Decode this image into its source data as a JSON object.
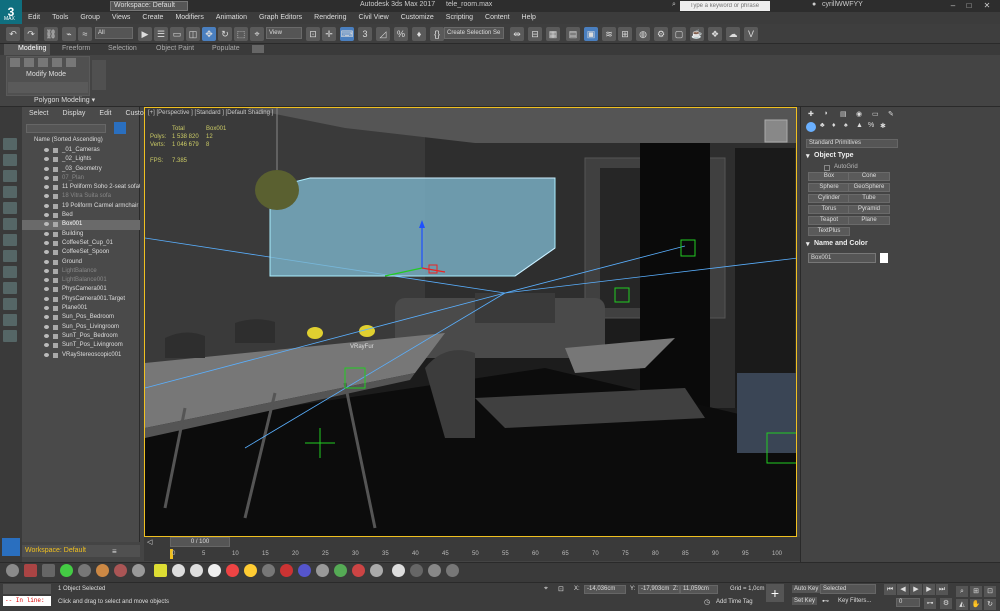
{
  "title_bar": {
    "logo_text": "3",
    "logo_sub": "MAX",
    "workspace": "Workspace: Default",
    "app_title": "Autodesk 3ds Max 2017",
    "file_name": "tele_room.max",
    "search_placeholder": "Type a keyword or phrase",
    "user": "cyrillWWFYY",
    "minimize": "–",
    "maximize": "□",
    "close": "✕"
  },
  "menu": [
    "Edit",
    "Tools",
    "Group",
    "Views",
    "Create",
    "Modifiers",
    "Animation",
    "Graph Editors",
    "Rendering",
    "Civil View",
    "Customize",
    "Scripting",
    "Content",
    "Help"
  ],
  "toolbar": {
    "filter": "All",
    "view": "View",
    "selection_set": "Create Selection Se",
    "undo": "↶",
    "redo": "↷",
    "link": "⛓",
    "select": "▶",
    "move": "✥",
    "rotate": "↻",
    "scale": "⬚",
    "snap": "3",
    "angle_snap": "◿",
    "percent_snap": "%",
    "spinner_snap": "♦",
    "mirror": "⇹",
    "align": "⊟",
    "render_setup": "⚙",
    "render": "☕"
  },
  "ribbon": {
    "tabs": [
      "Modeling",
      "Freeform",
      "Selection",
      "Object Paint",
      "Populate"
    ],
    "active_tab": "Modeling",
    "modify_mode": "Modify Mode",
    "polygon_modeling": "Polygon Modeling ▾"
  },
  "scene_explorer": {
    "tabs": [
      "Select",
      "Display",
      "Edit",
      "Customize"
    ],
    "header": "Name (Sorted Ascending)",
    "items": [
      {
        "name": "_01_Cameras",
        "state": "normal"
      },
      {
        "name": "_02_Lights",
        "state": "normal"
      },
      {
        "name": "_03_Geometry",
        "state": "normal"
      },
      {
        "name": "07_Plan",
        "state": "dim"
      },
      {
        "name": "11 Poliform Soho 2-seat sofa00",
        "state": "normal"
      },
      {
        "name": "18 Vitra Suita sofa",
        "state": "dim"
      },
      {
        "name": "19 Poliform Carmel armchair",
        "state": "normal"
      },
      {
        "name": "Bed",
        "state": "normal"
      },
      {
        "name": "Box001",
        "state": "sel"
      },
      {
        "name": "Building",
        "state": "normal"
      },
      {
        "name": "CoffeeSet_Cup_01",
        "state": "normal"
      },
      {
        "name": "CoffeeSet_Spoon",
        "state": "normal"
      },
      {
        "name": "Ground",
        "state": "normal"
      },
      {
        "name": "LightBalance",
        "state": "dim"
      },
      {
        "name": "LightBalance001",
        "state": "dim"
      },
      {
        "name": "PhysCamera001",
        "state": "normal"
      },
      {
        "name": "PhysCamera001.Target",
        "state": "normal"
      },
      {
        "name": "Plane001",
        "state": "normal"
      },
      {
        "name": "Sun_Pos_Bedroom",
        "state": "normal"
      },
      {
        "name": "Sun_Pos_Livingroom",
        "state": "normal"
      },
      {
        "name": "SunT_Pos_Bedroom",
        "state": "normal"
      },
      {
        "name": "SunT_Pos_Livingroom",
        "state": "normal"
      },
      {
        "name": "VRayStereoscopic001",
        "state": "normal"
      }
    ],
    "workspace": "Workspace: Default"
  },
  "viewport": {
    "label": "[+] [Perspective ] [Standard ] [Default Shading ]",
    "stats_total": "Total",
    "stats_object": "Box001",
    "polys_label": "Polys:",
    "polys_total": "1 538 820",
    "polys_obj": "12",
    "verts_label": "Verts:",
    "verts_total": "1 046 679",
    "verts_obj": "8",
    "fps_label": "FPS:",
    "fps": "7.385",
    "vray_label": "VRayFur"
  },
  "command_panel": {
    "category": "Standard Primitives",
    "object_type_header": "Object Type",
    "autogrid": "AutoGrid",
    "primitives": [
      "Box",
      "Cone",
      "Sphere",
      "GeoSphere",
      "Cylinder",
      "Tube",
      "Torus",
      "Pyramid",
      "Teapot",
      "Plane",
      "TextPlus"
    ],
    "name_color_header": "Name and Color",
    "object_name": "Box001",
    "object_color": "#ffffff"
  },
  "timeline": {
    "slider": "0 / 100",
    "ticks": [
      "0",
      "5",
      "10",
      "15",
      "20",
      "25",
      "30",
      "35",
      "40",
      "45",
      "50",
      "55",
      "60",
      "65",
      "70",
      "75",
      "80",
      "85",
      "90",
      "95",
      "100"
    ]
  },
  "status": {
    "maxscript": "-- In line:",
    "selected": "1 Object Selected",
    "hint": "Click and drag to select and move objects",
    "x_label": "X:",
    "x": "-14,036cm",
    "y_label": "Y:",
    "y": "-17,903cm",
    "z_label": "Z:",
    "z": "11,059cm",
    "grid": "Grid = 1,0cm",
    "add_time_tag": "Add Time Tag",
    "auto_key": "Auto Key",
    "set_key": "Set Key",
    "selected_drop": "Selected",
    "key_filters": "Key Filters...",
    "frame": "0",
    "plus": "+"
  },
  "colors": {
    "viewport_border": "#f0c020",
    "box_fill": "#7fb8d0",
    "selection_highlight": "#6a6a6a",
    "accent": "#0f6f7f"
  }
}
